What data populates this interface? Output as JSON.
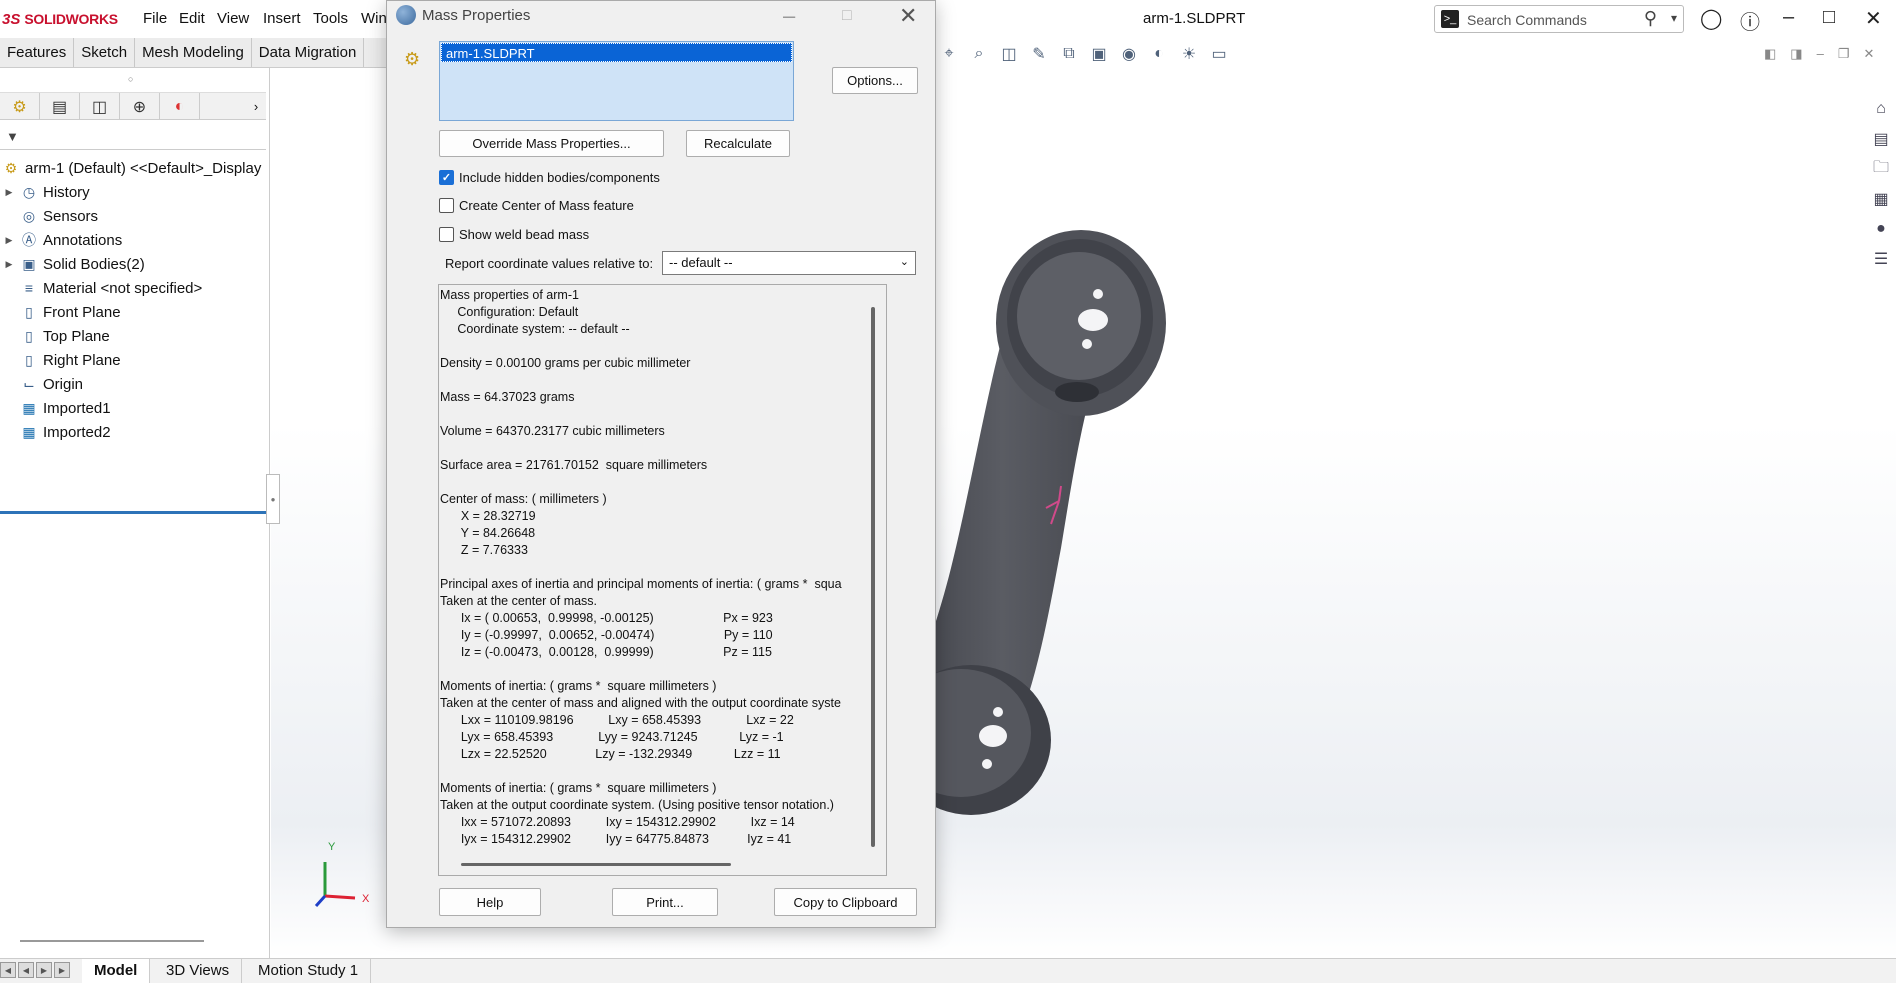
{
  "app": {
    "logo_ds": "3S",
    "logo_name": "SOLIDWORKS",
    "doc_title": "arm-1.SLDPRT"
  },
  "menu": [
    "File",
    "Edit",
    "View",
    "Insert",
    "Tools",
    "Win"
  ],
  "search": {
    "placeholder": "Search Commands"
  },
  "command_tabs": [
    "Features",
    "Sketch",
    "Mesh Modeling",
    "Data Migration"
  ],
  "tree": {
    "root": "arm-1 (Default) <<Default>_Display",
    "items": [
      {
        "label": "History",
        "expandable": true
      },
      {
        "label": "Sensors",
        "expandable": false
      },
      {
        "label": "Annotations",
        "expandable": true
      },
      {
        "label": "Solid Bodies(2)",
        "expandable": true
      },
      {
        "label": "Material <not specified>",
        "expandable": false
      },
      {
        "label": "Front Plane",
        "expandable": false
      },
      {
        "label": "Top Plane",
        "expandable": false
      },
      {
        "label": "Right Plane",
        "expandable": false
      },
      {
        "label": "Origin",
        "expandable": false
      },
      {
        "label": "Imported1",
        "expandable": false
      },
      {
        "label": "Imported2",
        "expandable": false
      }
    ]
  },
  "bottom_tabs": [
    "Model",
    "3D Views",
    "Motion Study 1"
  ],
  "triad": {
    "y": "Y",
    "x": "X"
  },
  "dialog": {
    "title": "Mass Properties",
    "selection": "arm-1.SLDPRT",
    "options_btn": "Options...",
    "override_btn": "Override Mass Properties...",
    "recalc_btn": "Recalculate",
    "cb_hidden": "Include hidden bodies/components",
    "cb_hidden_checked": true,
    "cb_com": "Create Center of Mass feature",
    "cb_weld": "Show weld bead mass",
    "coord_label": "Report coordinate values relative to:",
    "coord_value": "-- default --",
    "output": [
      "Mass properties of arm-1",
      "     Configuration: Default",
      "     Coordinate system: -- default --",
      "",
      "Density = 0.00100 grams per cubic millimeter",
      "",
      "Mass = 64.37023 grams",
      "",
      "Volume = 64370.23177 cubic millimeters",
      "",
      "Surface area = 21761.70152  square millimeters",
      "",
      "Center of mass: ( millimeters )",
      "      X = 28.32719",
      "      Y = 84.26648",
      "      Z = 7.76333",
      "",
      "Principal axes of inertia and principal moments of inertia: ( grams *  squa",
      "Taken at the center of mass.",
      "      Ix = ( 0.00653,  0.99998, -0.00125)                    Px = 923",
      "      Iy = (-0.99997,  0.00652, -0.00474)                    Py = 110",
      "      Iz = (-0.00473,  0.00128,  0.99999)                    Pz = 115",
      "",
      "Moments of inertia: ( grams *  square millimeters )",
      "Taken at the center of mass and aligned with the output coordinate syste",
      "      Lxx = 110109.98196          Lxy = 658.45393             Lxz = 22",
      "      Lyx = 658.45393             Lyy = 9243.71245            Lyz = -1",
      "      Lzx = 22.52520              Lzy = -132.29349            Lzz = 11",
      "",
      "Moments of inertia: ( grams *  square millimeters )",
      "Taken at the output coordinate system. (Using positive tensor notation.)",
      "      Ixx = 571072.20893          Ixy = 154312.29902          Ixz = 14",
      "      Iyx = 154312.29902          Iyy = 64775.84873           Iyz = 41"
    ],
    "help_btn": "Help",
    "print_btn": "Print...",
    "copy_btn": "Copy to Clipboard"
  },
  "colors": {
    "brand": "#c8102e",
    "selection": "#0a64d6",
    "part": "#55575e"
  }
}
